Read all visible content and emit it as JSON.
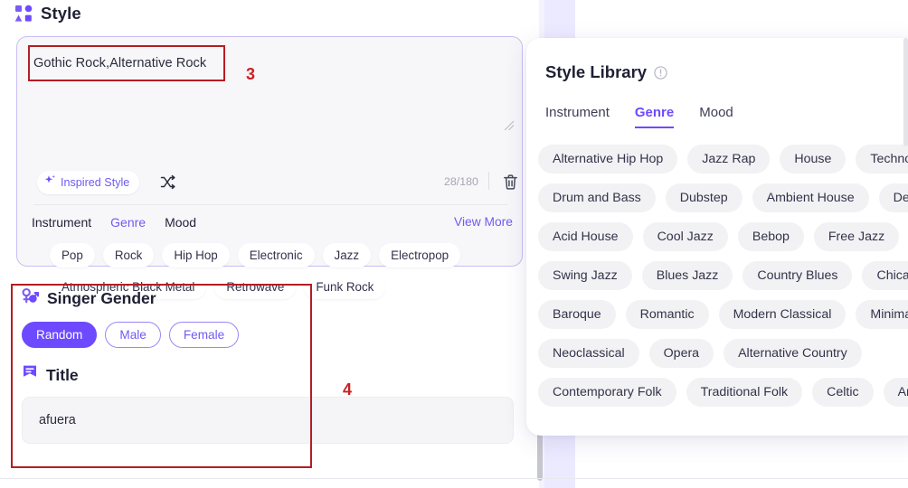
{
  "style_section": {
    "header_title": "Style",
    "header_icon": "grid-shapes-icon",
    "textarea_value": "Gothic Rock,Alternative Rock",
    "inspired_label": "Inspired Style",
    "inspired_icon": "sparkle-icon",
    "shuffle_icon": "shuffle-icon",
    "char_counter": "28/180",
    "delete_icon": "trash-icon",
    "resize_icon": "resize-handle-icon",
    "tabs": [
      {
        "label": "Instrument",
        "active": false
      },
      {
        "label": "Genre",
        "active": true
      },
      {
        "label": "Mood",
        "active": false
      }
    ],
    "view_more": "View More",
    "tag_rows": [
      [
        "Pop",
        "Rock",
        "Hip Hop",
        "Electronic",
        "Jazz",
        "Electropop"
      ],
      [
        "Atmospheric Black Metal",
        "Retrowave",
        "Funk Rock"
      ]
    ]
  },
  "singer_gender": {
    "header_title": "Singer Gender",
    "header_icon": "gender-symbols-icon",
    "options": [
      {
        "label": "Random",
        "selected": true
      },
      {
        "label": "Male",
        "selected": false
      },
      {
        "label": "Female",
        "selected": false
      }
    ]
  },
  "title_section": {
    "header_title": "Title",
    "header_icon": "bookmark-lines-icon",
    "input_value": "afuera",
    "input_placeholder": "afuera"
  },
  "annotations": [
    {
      "number": "3",
      "target": "style-textarea"
    },
    {
      "number": "4",
      "target": "singer-gender-and-title"
    }
  ],
  "style_library": {
    "title": "Style Library",
    "info_icon": "info-circle-icon",
    "tabs": [
      {
        "label": "Instrument",
        "active": false
      },
      {
        "label": "Genre",
        "active": true
      },
      {
        "label": "Mood",
        "active": false
      }
    ],
    "tag_rows": [
      [
        "Alternative Hip Hop",
        "Jazz Rap",
        "House",
        "Techno"
      ],
      [
        "Drum and Bass",
        "Dubstep",
        "Ambient House",
        "Deep House"
      ],
      [
        "Acid House",
        "Cool Jazz",
        "Bebop",
        "Free Jazz"
      ],
      [
        "Swing Jazz",
        "Blues Jazz",
        "Country Blues",
        "Chicago Blues"
      ],
      [
        "Baroque",
        "Romantic",
        "Modern Classical",
        "Minimalism"
      ],
      [
        "Neoclassical",
        "Opera",
        "Alternative Country"
      ],
      [
        "Contemporary Folk",
        "Traditional Folk",
        "Celtic",
        "Americana"
      ]
    ]
  },
  "colors": {
    "accent_purple": "#6d4aff",
    "accent_purple_text": "#6f5bf0",
    "annotation_red": "#b51d24",
    "card_bg": "#f7f7fa",
    "tag_bg": "#f2f2f4",
    "lavender_bg": "#eceaff"
  }
}
